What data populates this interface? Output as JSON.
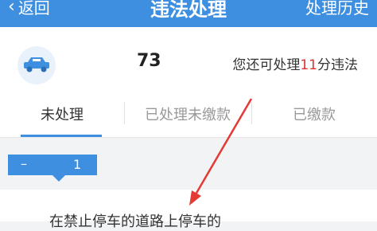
{
  "header": {
    "back_label": "返回",
    "title": "违法处理",
    "history_label": "处理历史"
  },
  "summary": {
    "points": "73",
    "remaining_prefix": "您还可处理",
    "remaining_count": "11",
    "remaining_suffix": "分违法"
  },
  "tabs": [
    {
      "label": "未处理",
      "active": true
    },
    {
      "label": "已处理未缴款",
      "active": false
    },
    {
      "label": "已缴款",
      "active": false
    }
  ],
  "badge": {
    "dash": "–",
    "count": "1"
  },
  "record": {
    "text": "在禁止停车的道路上停车的"
  },
  "colors": {
    "accent": "#3e8fe0",
    "highlight": "#e03030",
    "arrow": "#e53935"
  },
  "icons": {
    "back": "chevron-left-icon",
    "car": "car-icon"
  }
}
